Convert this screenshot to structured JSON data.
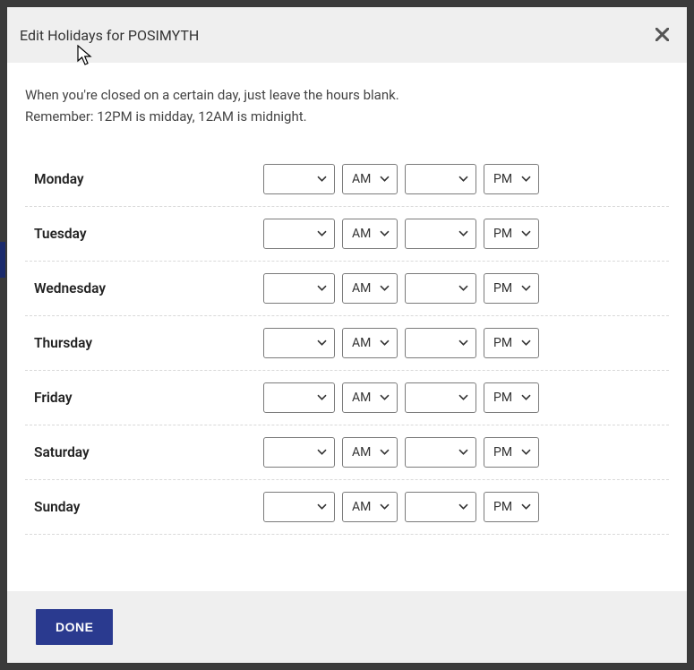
{
  "modal": {
    "title": "Edit Holidays for POSIMYTH",
    "close_label": "Close"
  },
  "instructions": {
    "line1": "When you're closed on a certain day, just leave the hours blank.",
    "line2": "Remember: 12PM is midday, 12AM is midnight."
  },
  "days": [
    {
      "name": "Monday",
      "open_hour": "",
      "open_period": "AM",
      "close_hour": "",
      "close_period": "PM"
    },
    {
      "name": "Tuesday",
      "open_hour": "",
      "open_period": "AM",
      "close_hour": "",
      "close_period": "PM"
    },
    {
      "name": "Wednesday",
      "open_hour": "",
      "open_period": "AM",
      "close_hour": "",
      "close_period": "PM"
    },
    {
      "name": "Thursday",
      "open_hour": "",
      "open_period": "AM",
      "close_hour": "",
      "close_period": "PM"
    },
    {
      "name": "Friday",
      "open_hour": "",
      "open_period": "AM",
      "close_hour": "",
      "close_period": "PM"
    },
    {
      "name": "Saturday",
      "open_hour": "",
      "open_period": "AM",
      "close_hour": "",
      "close_period": "PM"
    },
    {
      "name": "Sunday",
      "open_hour": "",
      "open_period": "AM",
      "close_hour": "",
      "close_period": "PM"
    }
  ],
  "footer": {
    "done_label": "DONE"
  },
  "colors": {
    "accent": "#2a3a8f",
    "header_bg": "#efefef",
    "border": "#7b7b7b"
  }
}
